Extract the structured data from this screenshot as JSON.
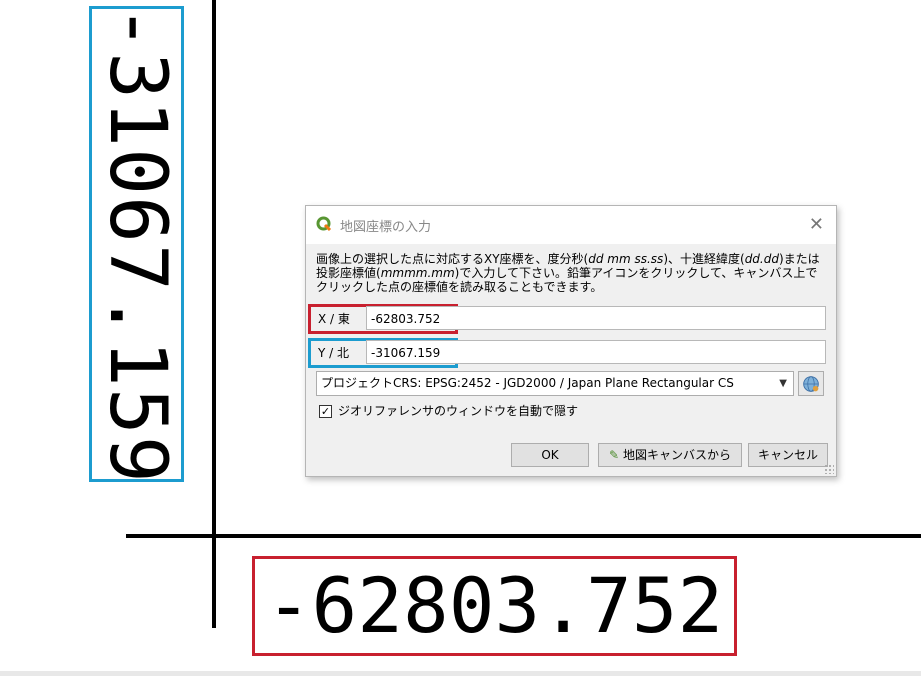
{
  "large_y_value": "-31067.159",
  "large_x_value": "-62803.752",
  "dialog": {
    "title": "地図座標の入力",
    "description_parts": {
      "p1": "画像上の選択した点に対応するXY座標を、度分秒(",
      "p1_em": "dd mm ss.ss",
      "p2": ")、十進経緯度(",
      "p2_em": "dd.dd",
      "p3": ")または投影座標値(",
      "p3_em": "mmmm.mm",
      "p4": ")で入力して下さい。鉛筆アイコンをクリックして、キャンバス上でクリックした点の座標値を読み取ることもできます。"
    },
    "x_label": "X / 東",
    "x_value": "-62803.752",
    "y_label": "Y / 北",
    "y_value": "-31067.159",
    "crs_select": "プロジェクトCRS: EPSG:2452 - JGD2000 / Japan Plane Rectangular CS",
    "checkbox_label": "ジオリファレンサのウィンドウを自動で隠す",
    "checkbox_checked": true,
    "ok_label": "OK",
    "from_canvas_label": "地図キャンバスから",
    "cancel_label": "キャンセル"
  },
  "colors": {
    "red_highlight": "#c8202f",
    "blue_highlight": "#1c9ccf",
    "qgis_green": "#589632"
  }
}
